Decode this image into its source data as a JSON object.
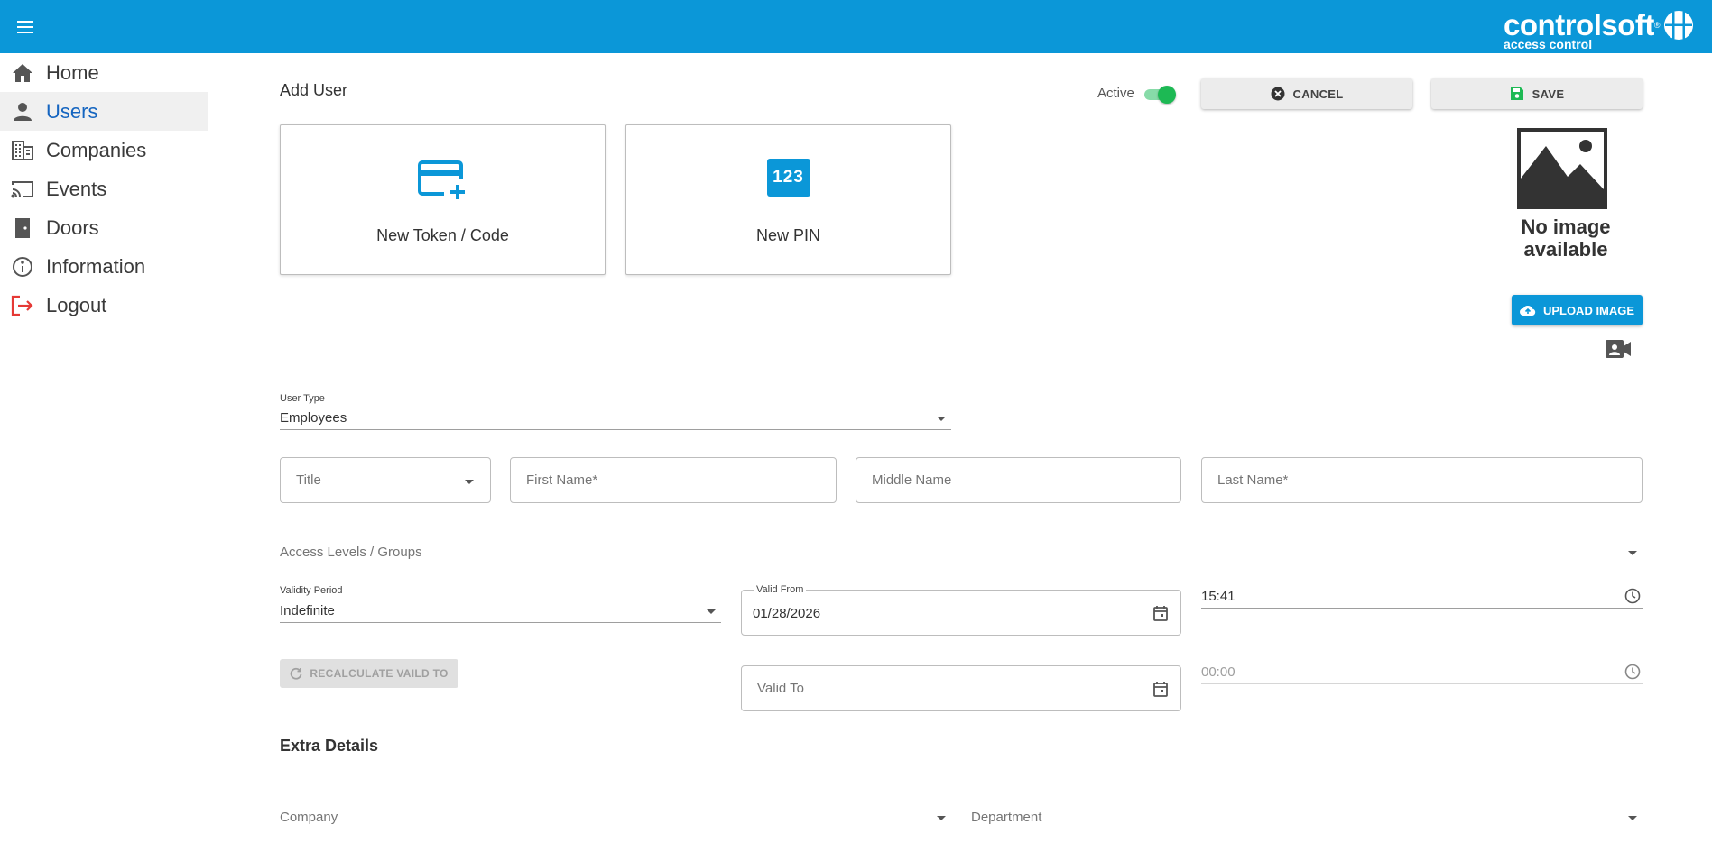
{
  "header": {
    "brand_name": "controlsoft",
    "brand_reg": "®",
    "brand_sub": "access control",
    "color": "#0b97d8"
  },
  "sidebar": {
    "items": [
      {
        "label": "Home",
        "icon": "home-icon"
      },
      {
        "label": "Users",
        "icon": "person-icon",
        "active": true
      },
      {
        "label": "Companies",
        "icon": "building-icon"
      },
      {
        "label": "Events",
        "icon": "cast-icon"
      },
      {
        "label": "Doors",
        "icon": "door-icon"
      },
      {
        "label": "Information",
        "icon": "info-icon"
      },
      {
        "label": "Logout",
        "icon": "logout-icon",
        "color": "#e53935"
      }
    ]
  },
  "main": {
    "title": "Add User",
    "active_label": "Active",
    "active_on": true,
    "cancel_label": "CANCEL",
    "save_label": "SAVE",
    "tiles": [
      {
        "label": "New Token / Code",
        "icon": "card-plus-icon"
      },
      {
        "label": "New PIN",
        "icon": "pin-123-icon",
        "icon_text": "123"
      }
    ],
    "no_image_line1": "No image",
    "no_image_line2": "available",
    "upload_label": "UPLOAD IMAGE"
  },
  "form": {
    "user_type_label": "User Type",
    "user_type_value": "Employees",
    "title_placeholder": "Title",
    "first_name_placeholder": "First Name*",
    "middle_name_placeholder": "Middle Name",
    "last_name_placeholder": "Last Name*",
    "access_levels_placeholder": "Access Levels / Groups",
    "validity_label": "Validity Period",
    "validity_value": "Indefinite",
    "valid_from_label": "Valid From",
    "valid_from_value": "01/28/2026",
    "valid_from_time": "15:41",
    "recalc_label": "RECALCULATE VAILD TO",
    "valid_to_placeholder": "Valid To",
    "valid_to_time": "00:00",
    "extra_title": "Extra Details",
    "company_placeholder": "Company",
    "department_placeholder": "Department"
  }
}
